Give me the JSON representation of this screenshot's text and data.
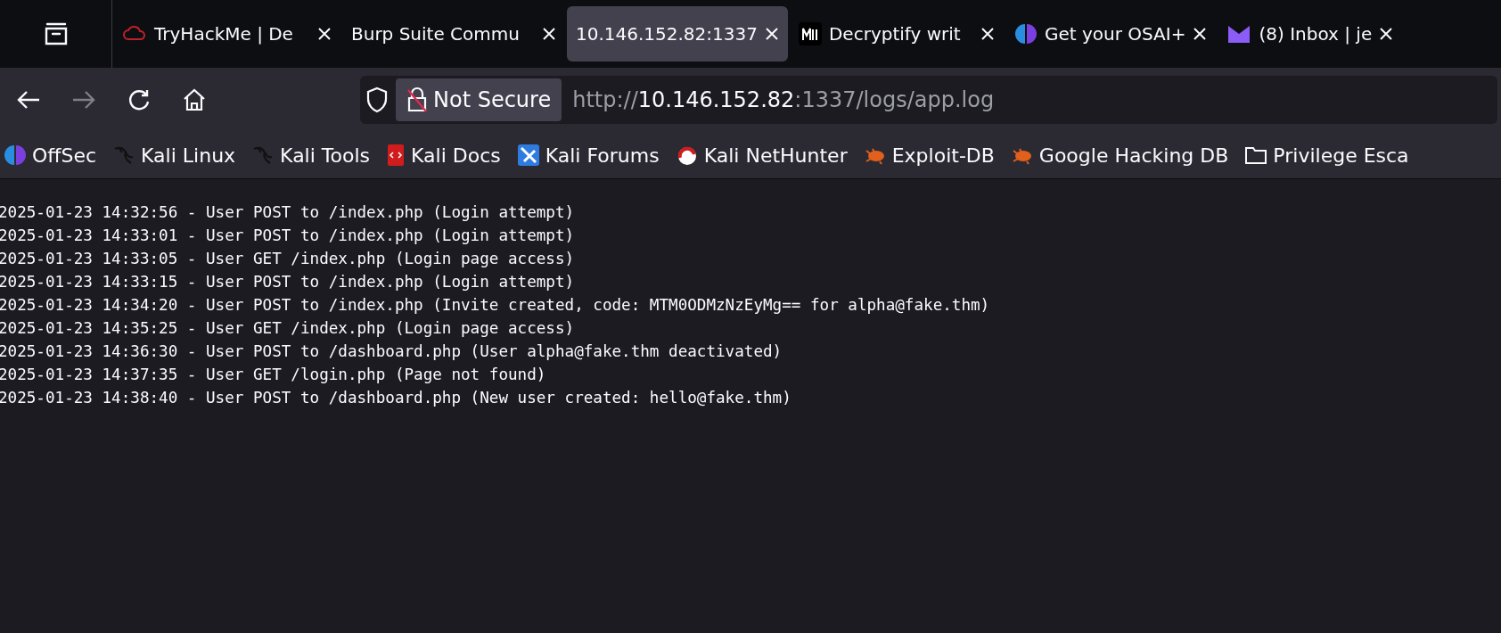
{
  "tabs": [
    {
      "title": "TryHackMe | De",
      "selected": false
    },
    {
      "title": "Burp Suite Commu",
      "selected": false
    },
    {
      "title": "10.146.152.82:1337",
      "selected": true
    },
    {
      "title": "Decryptify writ",
      "selected": false
    },
    {
      "title": "Get your OSAI+",
      "selected": false
    },
    {
      "title": "(8) Inbox | je",
      "selected": false
    }
  ],
  "navigation": {
    "forward_disabled": true
  },
  "address_bar": {
    "security": "Not Secure",
    "scheme": "http://",
    "host": "10.146.152.82",
    "rest": ":1337/logs/app.log"
  },
  "bookmarks": [
    {
      "label": "OffSec"
    },
    {
      "label": "Kali Linux"
    },
    {
      "label": "Kali Tools"
    },
    {
      "label": "Kali Docs"
    },
    {
      "label": "Kali Forums"
    },
    {
      "label": "Kali NetHunter"
    },
    {
      "label": "Exploit-DB"
    },
    {
      "label": "Google Hacking DB"
    },
    {
      "label": "Privilege Esca"
    }
  ],
  "log_lines": [
    "2025-01-23 14:32:56 - User POST to /index.php (Login attempt)",
    "2025-01-23 14:33:01 - User POST to /index.php (Login attempt)",
    "2025-01-23 14:33:05 - User GET /index.php (Login page access)",
    "2025-01-23 14:33:15 - User POST to /index.php (Login attempt)",
    "2025-01-23 14:34:20 - User POST to /index.php (Invite created, code: MTM0ODMzNzEyMg== for alpha@fake.thm)",
    "2025-01-23 14:35:25 - User GET /index.php (Login page access)",
    "2025-01-23 14:36:30 - User POST to /dashboard.php (User alpha@fake.thm deactivated)",
    "2025-01-23 14:37:35 - User GET /login.php (Page not found)",
    "2025-01-23 14:38:40 - User POST to /dashboard.php (New user created: hello@fake.thm)"
  ]
}
